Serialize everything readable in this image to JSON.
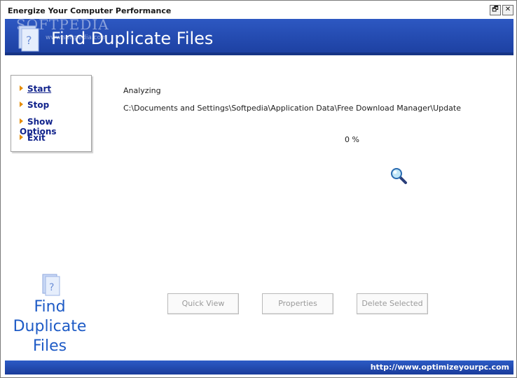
{
  "window": {
    "title": "Energize Your Computer Performance",
    "restore_symbol": "🗗",
    "close_symbol": "✕"
  },
  "header": {
    "title": "Find Duplicate Files",
    "watermark": "SOFTPEDIA",
    "watermark_url": "www.softpedia.com"
  },
  "sidebar": {
    "items": [
      {
        "label": "Start"
      },
      {
        "label": "Stop"
      },
      {
        "label": "Show Options"
      },
      {
        "label": "Exit"
      }
    ]
  },
  "main": {
    "status": "Analyzing",
    "current_path": "C:\\Documents and Settings\\Softpedia\\Application Data\\Free Download Manager\\Update",
    "progress_text": "0 %",
    "progress": 0
  },
  "buttons": {
    "quick_view": "Quick View",
    "properties": "Properties",
    "delete_selected": "Delete Selected"
  },
  "branding": {
    "line1": "Find",
    "line2": "Duplicate",
    "line3": "Files"
  },
  "footer": {
    "url": "http://www.optimizeyourpc.com"
  },
  "icons": [
    "restore-icon",
    "close-icon",
    "document-icon",
    "magnifier-icon",
    "arrow-bullet-icon"
  ],
  "colors": {
    "header_blue": "#2d58c2",
    "menu_text": "#12248c",
    "bullet": "#e58c00",
    "brand_text": "#1e5bc6"
  }
}
